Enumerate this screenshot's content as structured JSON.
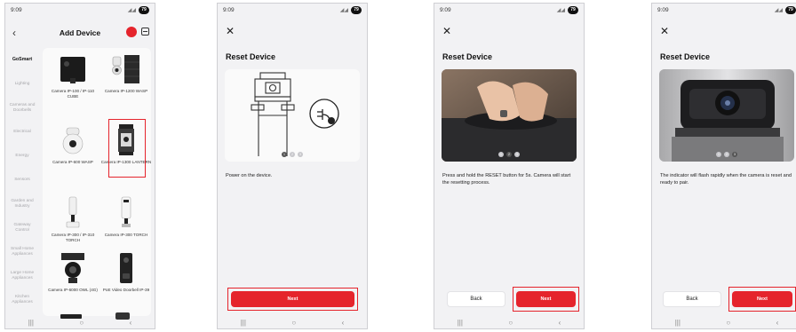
{
  "status": {
    "time": "9:09",
    "battery": "79"
  },
  "screen1": {
    "title": "Add Device",
    "categories": [
      "GoSmart",
      "Lighting",
      "Cameras and Doorbells",
      "Electrical",
      "Energy",
      "Sensors",
      "Garden and Industry",
      "Gateway Control",
      "Small Home Appliances",
      "Large Home Appliances",
      "Kitchen Appliances"
    ],
    "products": [
      "Camera IP-100 / IP-110 CUBE",
      "Camera IP-1200 WASP",
      "Camera IP-600 WASP",
      "Camera IP-1300 LANTERN",
      "Camera IP-300 / IP-310 TORCH",
      "Camera IP-300 TORCH",
      "Camera IP-6000 OWL (4G)",
      "PoE Video Doorbell IP-39"
    ]
  },
  "screen2": {
    "title": "Reset Device",
    "instruction": "Power on the device.",
    "next": "Next",
    "dots": [
      "1",
      "2",
      "3"
    ]
  },
  "screen3": {
    "title": "Reset Device",
    "instruction": "Press and hold the RESET button for 5s. Camera will start the resetting process.",
    "back": "Back",
    "next": "Next",
    "dots": [
      "1",
      "2",
      "3"
    ]
  },
  "screen4": {
    "title": "Reset Device",
    "instruction": "The indicator will flash rapidly when the camera is reset and ready to pair.",
    "back": "Back",
    "next": "Next",
    "dots": [
      "1",
      "2",
      "3"
    ]
  },
  "colors": {
    "accent": "#e5242c",
    "background": "#f2f2f4"
  }
}
